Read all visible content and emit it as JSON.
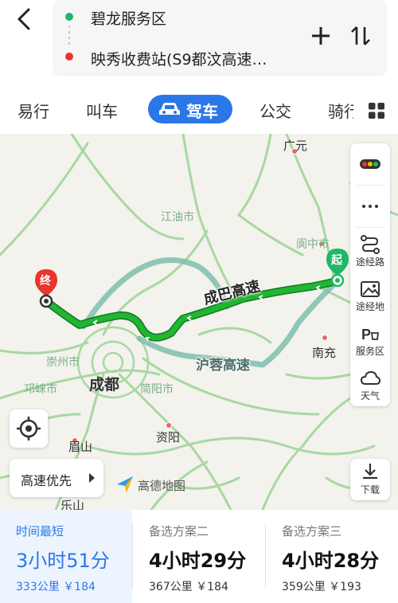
{
  "header": {
    "origin": "碧龙服务区",
    "destination": "映秀收费站(S9都汶高速…"
  },
  "tabs": [
    {
      "label": "易行"
    },
    {
      "label": "叫车"
    },
    {
      "label": "驾车",
      "selected": true
    },
    {
      "label": "公交"
    },
    {
      "label": "骑行"
    }
  ],
  "map": {
    "cities": {
      "guangyuan": "广元",
      "jiangyou": "江油市",
      "langzhong": "阆中市",
      "chongzhou": "崇州市",
      "qionglai": "邛崃市",
      "chengdu": "成都",
      "jianyang": "简阳市",
      "nanchong": "南充",
      "meishan": "眉山",
      "ziyang": "资阳",
      "leshan": "乐山"
    },
    "roads": {
      "main": "成巴高速",
      "alt": "沪蓉高速"
    },
    "markers": {
      "start": "起",
      "end": "终"
    },
    "route_color": "#1fa52c",
    "alt_route_color": "#7fbfae",
    "road_color": "#a8d8a0"
  },
  "tools": {
    "waypoint_route": "途经路",
    "waypoint_place": "途经地",
    "service_area": "服务区",
    "weather": "天气",
    "download": "下载"
  },
  "preference": "高速优先",
  "logo": "高德地图",
  "plans": [
    {
      "title": "时间最短",
      "duration": "3小时51分",
      "meta": "333公里 ￥184",
      "selected": true
    },
    {
      "title": "备选方案二",
      "duration": "4小时29分",
      "meta": "367公里 ￥184"
    },
    {
      "title": "备选方案三",
      "duration": "4小时28分",
      "meta": "359公里 ￥193"
    }
  ],
  "accent_color": "#2b77e8"
}
